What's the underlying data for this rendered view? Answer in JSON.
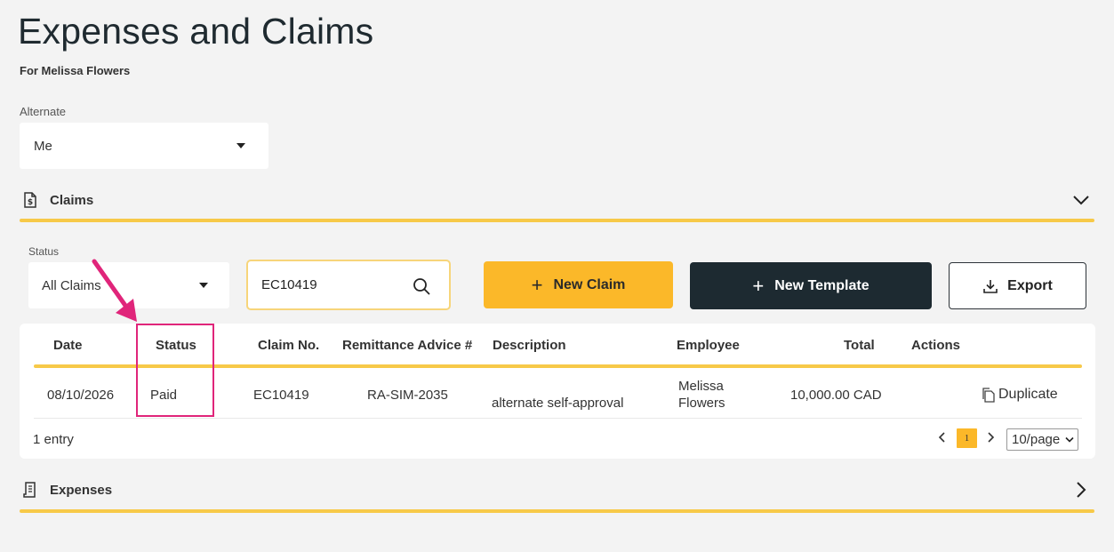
{
  "header": {
    "title": "Expenses and Claims",
    "subtitle": "For Melissa Flowers"
  },
  "alternate": {
    "label": "Alternate",
    "value": "Me"
  },
  "sections": {
    "claims": "Claims",
    "expenses": "Expenses"
  },
  "filters": {
    "status_label": "Status",
    "status_value": "All Claims",
    "search_value": "EC10419"
  },
  "buttons": {
    "new_claim": "New Claim",
    "new_template": "New Template",
    "export": "Export"
  },
  "table": {
    "columns": {
      "date": "Date",
      "status": "Status",
      "claim_no": "Claim No.",
      "remittance": "Remittance Advice #",
      "description": "Description",
      "employee": "Employee",
      "total": "Total",
      "actions": "Actions"
    },
    "rows": [
      {
        "date": "08/10/2026",
        "status": "Paid",
        "claim_no": "EC10419",
        "remittance": "RA-SIM-2035",
        "description": "alternate self-approval",
        "employee_line1": "Melissa",
        "employee_line2": "Flowers",
        "total": "10,000.00 CAD",
        "action": "Duplicate"
      }
    ],
    "entry_count": "1  entry"
  },
  "pagination": {
    "current_page": "1",
    "page_size": "10/page"
  },
  "colors": {
    "accent_yellow": "#fbb829",
    "rule_yellow": "#f7c948",
    "dark_button": "#1d2a31",
    "highlight_pink": "#e0257a"
  },
  "icons": {
    "alternate_caret": "caret-down-icon",
    "claims_section": "receipt-dollar-icon",
    "claims_toggle": "chevron-down-icon",
    "search": "search-icon",
    "new_claim": "plus-icon",
    "new_template": "plus-icon",
    "export": "download-icon",
    "duplicate": "copy-icon",
    "prev_page": "chevron-left-icon",
    "next_page": "chevron-right-icon",
    "expenses_section": "receipt-icon",
    "expenses_toggle": "chevron-right-icon"
  }
}
